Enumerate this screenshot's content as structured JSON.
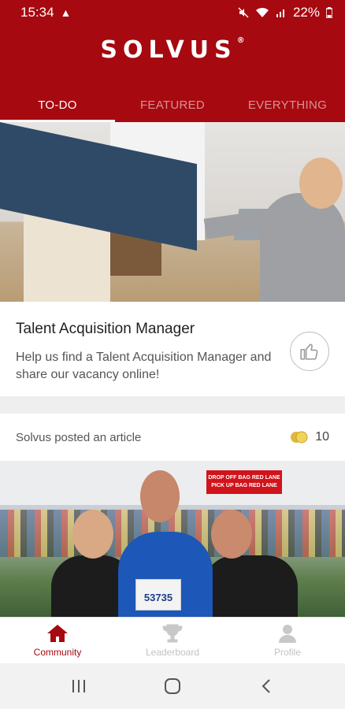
{
  "status_bar": {
    "time": "15:34",
    "battery": "22%",
    "icons": [
      "warning-icon",
      "mute-icon",
      "wifi-icon",
      "signal-icon",
      "battery-icon"
    ]
  },
  "header": {
    "logo": "SOLVUS",
    "logo_mark": "®",
    "brand_color": "#a6090f"
  },
  "tabs": [
    {
      "label": "TO-DO",
      "active": true
    },
    {
      "label": "FEATURED",
      "active": false
    },
    {
      "label": "EVERYTHING",
      "active": false
    }
  ],
  "card1": {
    "title": "Talent Acquisition Manager",
    "description": "Help us find a Talent Acquisition Manager and share our vacancy online!",
    "icon": "thumbs-up-icon"
  },
  "card2": {
    "meta": "Solvus posted an article",
    "coin_count": "10",
    "icon": "coins-icon",
    "photo_banner": "DROP OFF BAG RED LANE PICK UP BAG RED LANE",
    "bib_number": "53735"
  },
  "bottom_nav": [
    {
      "label": "Community",
      "icon": "home-icon",
      "active": true
    },
    {
      "label": "Leaderboard",
      "icon": "trophy-icon",
      "active": false
    },
    {
      "label": "Profile",
      "icon": "profile-icon",
      "active": false
    }
  ]
}
